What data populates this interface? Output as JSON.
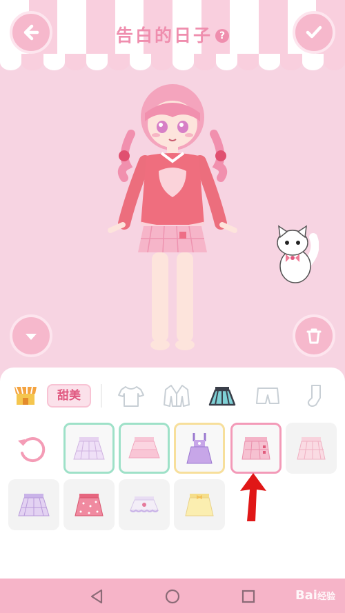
{
  "header": {
    "title": "告白的日子",
    "help_label": "?",
    "back_icon": "arrow-left-icon",
    "confirm_icon": "check-icon"
  },
  "stage": {
    "down_icon": "chevron-down-icon",
    "delete_icon": "trash-icon"
  },
  "categories": {
    "shop_icon": "shop-icon",
    "style_tag": "甜美",
    "items": [
      "shirt-icon",
      "jacket-icon",
      "skirt-icon",
      "shorts-icon",
      "sock-icon"
    ],
    "active": "skirt-icon"
  },
  "items": [
    {
      "name": "skirt-lavender-pleated",
      "color": "#e6d2f0",
      "state": "equipped-green"
    },
    {
      "name": "skirt-pink-tiered",
      "color": "#f7c6d6",
      "state": "equipped-green"
    },
    {
      "name": "dress-purple-overall",
      "color": "#c7a6e8",
      "state": "equipped-yellow"
    },
    {
      "name": "skirt-pink-plaid-wrap",
      "color": "#f4b3c7",
      "state": "selected"
    },
    {
      "name": "skirt-pink-plaid",
      "color": "#f8d3dd",
      "state": "none"
    },
    {
      "name": "skirt-purple-plaid",
      "color": "#e3d2f2",
      "state": "none"
    },
    {
      "name": "skirt-red-polka",
      "color": "#f08aa0",
      "state": "none"
    },
    {
      "name": "skirt-white-frill",
      "color": "#f3eef7",
      "state": "none"
    },
    {
      "name": "skirt-yellow-bow",
      "color": "#fbeeb0",
      "state": "none"
    }
  ],
  "colors": {
    "accent": "#ef8eae",
    "button": "#f6b8cc",
    "background": "#f7d4e2",
    "arrow": "#e01717"
  },
  "navbar": {
    "watermark": "Bai",
    "watermark_suffix": "经验"
  }
}
